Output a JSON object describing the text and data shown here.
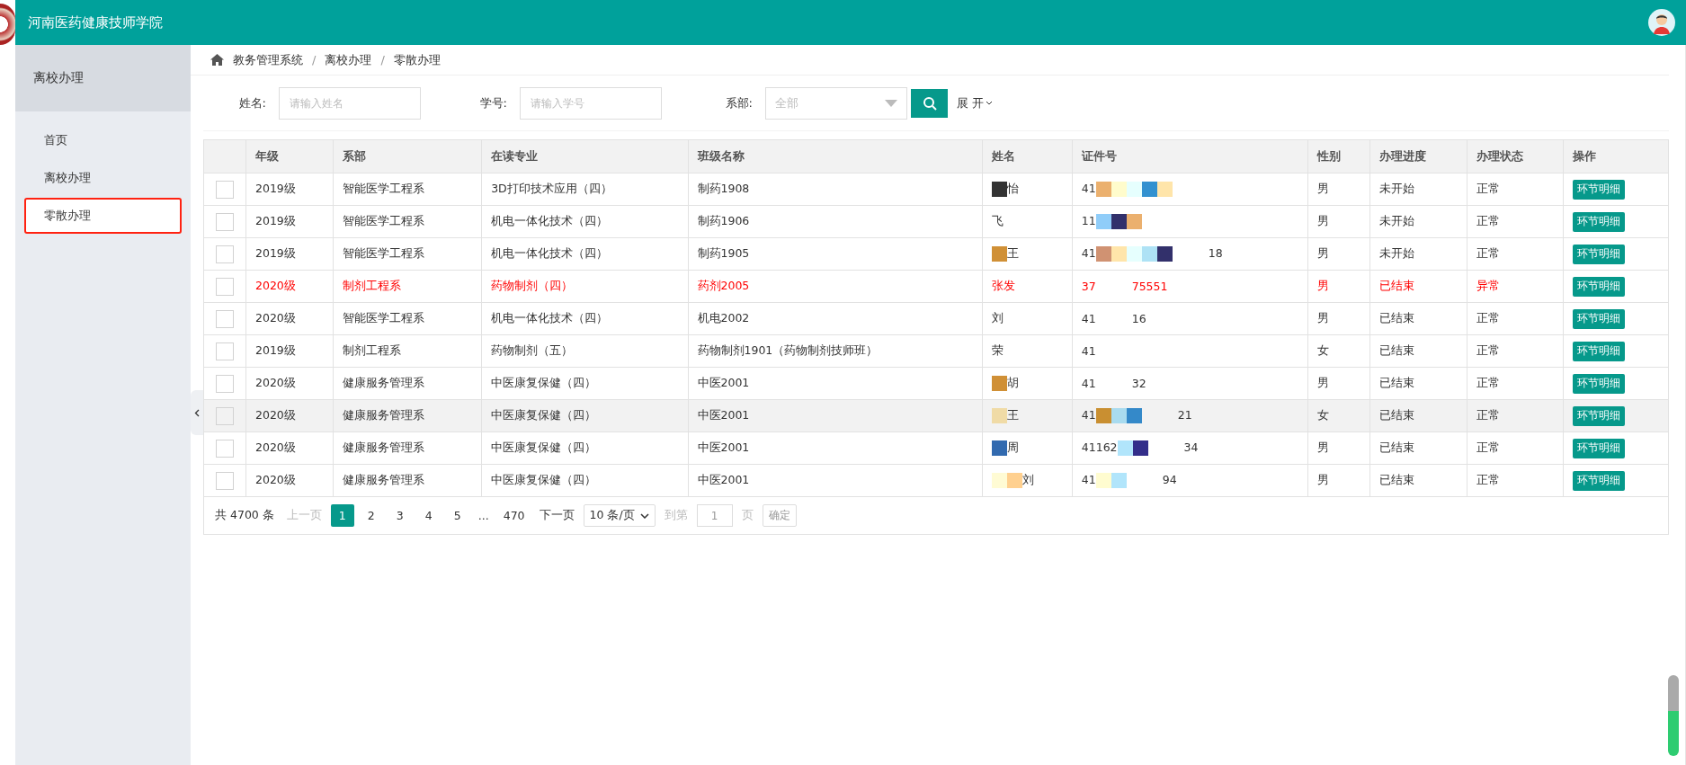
{
  "header": {
    "title": "河南医药健康技师学院"
  },
  "sidebar": {
    "title": "离校办理",
    "items": [
      {
        "label": "首页",
        "selected": false
      },
      {
        "label": "离校办理",
        "selected": false
      },
      {
        "label": "零散办理",
        "selected": true
      }
    ]
  },
  "breadcrumb": {
    "items": [
      "教务管理系统",
      "离校办理",
      "零散办理"
    ],
    "separator": "/"
  },
  "filters": {
    "name_label": "姓名:",
    "name_placeholder": "请输入姓名",
    "id_label": "学号:",
    "id_placeholder": "请输入学号",
    "dept_label": "系部:",
    "dept_value": "全部",
    "expand": "展 开"
  },
  "table": {
    "columns": [
      "年级",
      "系部",
      "在读专业",
      "班级名称",
      "姓名",
      "证件号",
      "性别",
      "办理进度",
      "办理状态",
      "操作"
    ],
    "rows": [
      {
        "checked": false,
        "alert": false,
        "hovered": false,
        "cells": [
          "2019级",
          "智能医学工程系",
          "3D打印技术应用（四）",
          "制药1908"
        ],
        "name": {
          "text": "怡",
          "masks": [
            {
              "color": "#333333"
            }
          ]
        },
        "id": {
          "prefix": "41",
          "masks": [
            {
              "color": "#ebb06e"
            },
            {
              "color": "#fffccc"
            },
            {
              "color": "#e6fffe"
            },
            {
              "color": "#3291d0"
            },
            {
              "color": "#ffe5aa"
            }
          ]
        },
        "tail": [
          "男",
          "未开始",
          "正常"
        ],
        "action": "环节明细"
      },
      {
        "checked": false,
        "alert": false,
        "hovered": false,
        "cells": [
          "2019级",
          "智能医学工程系",
          "机电一体化技术（四）",
          "制药1906"
        ],
        "name": {
          "text": "飞"
        },
        "id": {
          "prefix": "11",
          "masks": [
            {
              "color": "#90cdf9"
            },
            {
              "color": "#32306b"
            },
            {
              "color": "#ebb06e"
            }
          ]
        },
        "tail": [
          "男",
          "未开始",
          "正常"
        ],
        "action": "环节明细"
      },
      {
        "checked": false,
        "alert": false,
        "hovered": false,
        "cells": [
          "2019级",
          "智能医学工程系",
          "机电一体化技术（四）",
          "制药1905"
        ],
        "name": {
          "text": "王",
          "masks": [
            {
              "color": "#d09036"
            }
          ]
        },
        "id": {
          "prefix": "41",
          "masks": [
            {
              "color": "#d09272"
            },
            {
              "color": "#ffe5aa"
            },
            {
              "color": "#e6fffe"
            },
            {
              "color": "#aee2f5"
            },
            {
              "color": "#32306b"
            }
          ],
          "suffix": "18"
        },
        "tail": [
          "男",
          "未开始",
          "正常"
        ],
        "action": "环节明细"
      },
      {
        "checked": false,
        "alert": true,
        "hovered": false,
        "cells": [
          "2020级",
          "制剂工程系",
          "药物制剂（四）",
          "药剂2005"
        ],
        "name": {
          "text": "张发"
        },
        "id": {
          "prefix": "37",
          "suffix": "75551"
        },
        "tail": [
          "男",
          "已结束",
          "异常"
        ],
        "action": "环节明细"
      },
      {
        "checked": false,
        "alert": false,
        "hovered": false,
        "cells": [
          "2020级",
          "智能医学工程系",
          "机电一体化技术（四）",
          "机电2002"
        ],
        "name": {
          "text": "刘"
        },
        "id": {
          "prefix": "41",
          "suffix": "16"
        },
        "tail": [
          "男",
          "已结束",
          "正常"
        ],
        "action": "环节明细"
      },
      {
        "checked": false,
        "alert": false,
        "hovered": false,
        "cells": [
          "2019级",
          "制剂工程系",
          "药物制剂（五）",
          "药物制剂1901（药物制剂技师班）"
        ],
        "name": {
          "text": "荣"
        },
        "id": {
          "prefix": "41"
        },
        "tail": [
          "女",
          "已结束",
          "正常"
        ],
        "action": "环节明细"
      },
      {
        "checked": false,
        "alert": false,
        "hovered": false,
        "cells": [
          "2020级",
          "健康服务管理系",
          "中医康复保健（四）",
          "中医2001"
        ],
        "name": {
          "text": "胡",
          "masks": [
            {
              "color": "#d09036"
            }
          ]
        },
        "id": {
          "prefix": "41",
          "suffix": "32"
        },
        "tail": [
          "男",
          "已结束",
          "正常"
        ],
        "action": "环节明细"
      },
      {
        "checked": false,
        "alert": false,
        "hovered": true,
        "cells": [
          "2020级",
          "健康服务管理系",
          "中医康复保健（四）",
          "中医2001"
        ],
        "name": {
          "text": "王",
          "masks": [
            {
              "color": "#f0dba6"
            }
          ]
        },
        "id": {
          "prefix": "41",
          "masks": [
            {
              "color": "#c98f31"
            },
            {
              "color": "#a9dbef"
            },
            {
              "color": "#3489c9"
            }
          ],
          "suffix": "21"
        },
        "tail": [
          "女",
          "已结束",
          "正常"
        ],
        "action": "环节明细"
      },
      {
        "checked": false,
        "alert": false,
        "hovered": false,
        "cells": [
          "2020级",
          "健康服务管理系",
          "中医康复保健（四）",
          "中医2001"
        ],
        "name": {
          "text": "周",
          "masks": [
            {
              "color": "#326aaf"
            }
          ]
        },
        "id": {
          "prefix": "41162",
          "masks": [
            {
              "color": "#b1e5fb"
            },
            {
              "color": "#332e8a"
            }
          ],
          "suffix": "34"
        },
        "tail": [
          "男",
          "已结束",
          "正常"
        ],
        "action": "环节明细"
      },
      {
        "checked": false,
        "alert": false,
        "hovered": false,
        "cells": [
          "2020级",
          "健康服务管理系",
          "中医康复保健（四）",
          "中医2001"
        ],
        "name": {
          "text": "刘",
          "masks": [
            {
              "color": "#fffbd4"
            },
            {
              "color": "#ffd08f"
            }
          ]
        },
        "id": {
          "prefix": "41",
          "masks": [
            {
              "color": "#fffcd0"
            },
            {
              "color": "#b1e5fb"
            }
          ],
          "suffix": "94"
        },
        "tail": [
          "男",
          "已结束",
          "正常"
        ],
        "action": "环节明细"
      }
    ]
  },
  "pagination": {
    "total": "共 4700 条",
    "prev": "上一页",
    "pages": [
      {
        "label": "1",
        "selected": true
      },
      {
        "label": "2",
        "selected": false
      },
      {
        "label": "3",
        "selected": false
      },
      {
        "label": "4",
        "selected": false
      },
      {
        "label": "5",
        "selected": false
      }
    ],
    "ellipsis": "...",
    "last": "470",
    "next": "下一页",
    "page_size": "10 条/页",
    "goto_label": "到第",
    "goto_value": "1",
    "page_unit": "页",
    "confirm": "确定"
  }
}
